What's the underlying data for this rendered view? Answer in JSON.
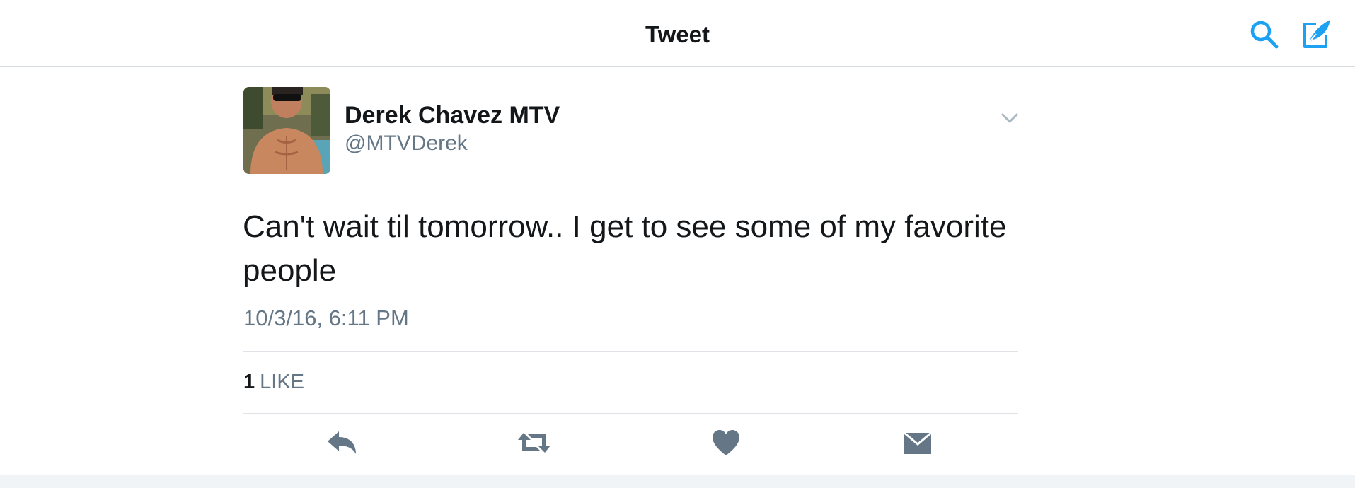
{
  "header": {
    "title": "Tweet",
    "search_icon": "search-icon",
    "compose_icon": "compose-tweet-icon",
    "accent_color": "#1da1f2"
  },
  "tweet": {
    "author": {
      "display_name": "Derek Chavez MTV",
      "handle": "@MTVDerek",
      "avatar_icon": "avatar"
    },
    "text": "Can't wait til tomorrow.. I get to see some of my favorite people",
    "timestamp": "10/3/16, 6:11 PM",
    "stats": {
      "likes_count": "1",
      "likes_label": "LIKE"
    },
    "actions": [
      "reply-icon",
      "retweet-icon",
      "heart-icon",
      "direct-message-icon"
    ],
    "action_color": "#657786"
  }
}
